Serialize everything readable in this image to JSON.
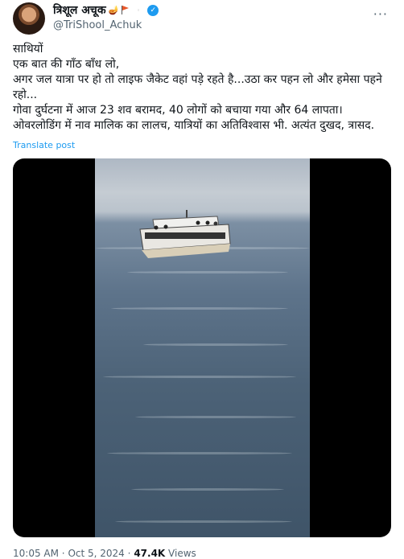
{
  "author": {
    "display_name": "त्रिशूल अचूक",
    "handle": "@TriShool_Achuk",
    "name_badges": [
      "diya-emoji",
      "saffron-flag-emoji",
      "india-flag-emoji",
      "verified-badge"
    ]
  },
  "tweet": {
    "text": "साथियों\nएक बात की गाँठ बाँध लो,\nअगर जल यात्रा पर हो तो लाइफ जैकेट वहां पड़े रहते है...उठा कर पहन लो और हमेसा पहने रहो...\nगोवा दुर्घटना में आज 23 शव बरामद, 40 लोगों को बचाया गया और 64 लापता।\nओवरलोडिंग में नाव मालिक का लालच, यात्रियों का अतिविश्वास भी. अत्यंत दुखद, त्रासद.",
    "translate_label": "Translate post"
  },
  "meta": {
    "time": "10:05 AM",
    "date": "Oct 5, 2024",
    "views_count": "47.4K",
    "views_label": "Views",
    "separator": "·"
  },
  "colors": {
    "link": "#1d9bf0",
    "muted": "#536471"
  }
}
